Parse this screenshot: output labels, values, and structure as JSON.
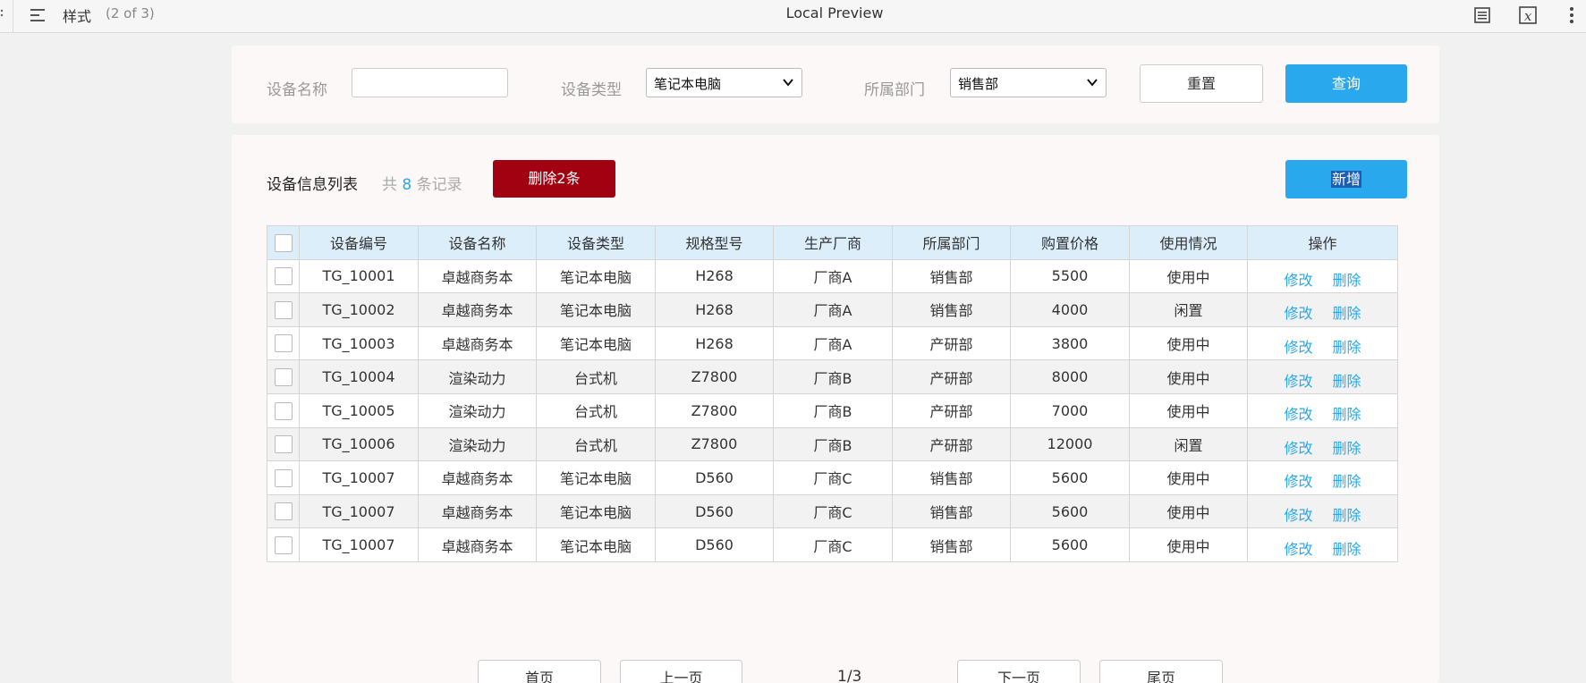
{
  "topbar": {
    "page_title": "样式",
    "page_count": "(2 of 3)",
    "app_title": "Local Preview"
  },
  "filter": {
    "name_label": "设备名称",
    "name_value": "",
    "type_label": "设备类型",
    "type_value": "笔记本电脑",
    "dept_label": "所属部门",
    "dept_value": "销售部",
    "reset_label": "重置",
    "query_label": "查询"
  },
  "list": {
    "title": "设备信息列表",
    "count_prefix": "共",
    "count": "8",
    "count_suffix": "条记录",
    "delete_label": "删除2条",
    "add_label": "新增"
  },
  "table": {
    "headers": [
      "设备编号",
      "设备名称",
      "设备类型",
      "规格型号",
      "生产厂商",
      "所属部门",
      "购置价格",
      "使用情况",
      "操作"
    ],
    "edit_label": "修改",
    "remove_label": "删除",
    "rows": [
      [
        "TG_10001",
        "卓越商务本",
        "笔记本电脑",
        "H268",
        "厂商A",
        "销售部",
        "5500",
        "使用中"
      ],
      [
        "TG_10002",
        "卓越商务本",
        "笔记本电脑",
        "H268",
        "厂商A",
        "销售部",
        "4000",
        "闲置"
      ],
      [
        "TG_10003",
        "卓越商务本",
        "笔记本电脑",
        "H268",
        "厂商A",
        "产研部",
        "3800",
        "使用中"
      ],
      [
        "TG_10004",
        "渲染动力",
        "台式机",
        "Z7800",
        "厂商B",
        "产研部",
        "8000",
        "使用中"
      ],
      [
        "TG_10005",
        "渲染动力",
        "台式机",
        "Z7800",
        "厂商B",
        "产研部",
        "7000",
        "使用中"
      ],
      [
        "TG_10006",
        "渲染动力",
        "台式机",
        "Z7800",
        "厂商B",
        "产研部",
        "12000",
        "闲置"
      ],
      [
        "TG_10007",
        "卓越商务本",
        "笔记本电脑",
        "D560",
        "厂商C",
        "销售部",
        "5600",
        "使用中"
      ],
      [
        "TG_10007",
        "卓越商务本",
        "笔记本电脑",
        "D560",
        "厂商C",
        "销售部",
        "5600",
        "使用中"
      ],
      [
        "TG_10007",
        "卓越商务本",
        "笔记本电脑",
        "D560",
        "厂商C",
        "销售部",
        "5600",
        "使用中"
      ]
    ]
  },
  "pager": {
    "first": "首页",
    "prev": "上一页",
    "page": "1/3",
    "next": "下一页",
    "last": "尾页"
  }
}
